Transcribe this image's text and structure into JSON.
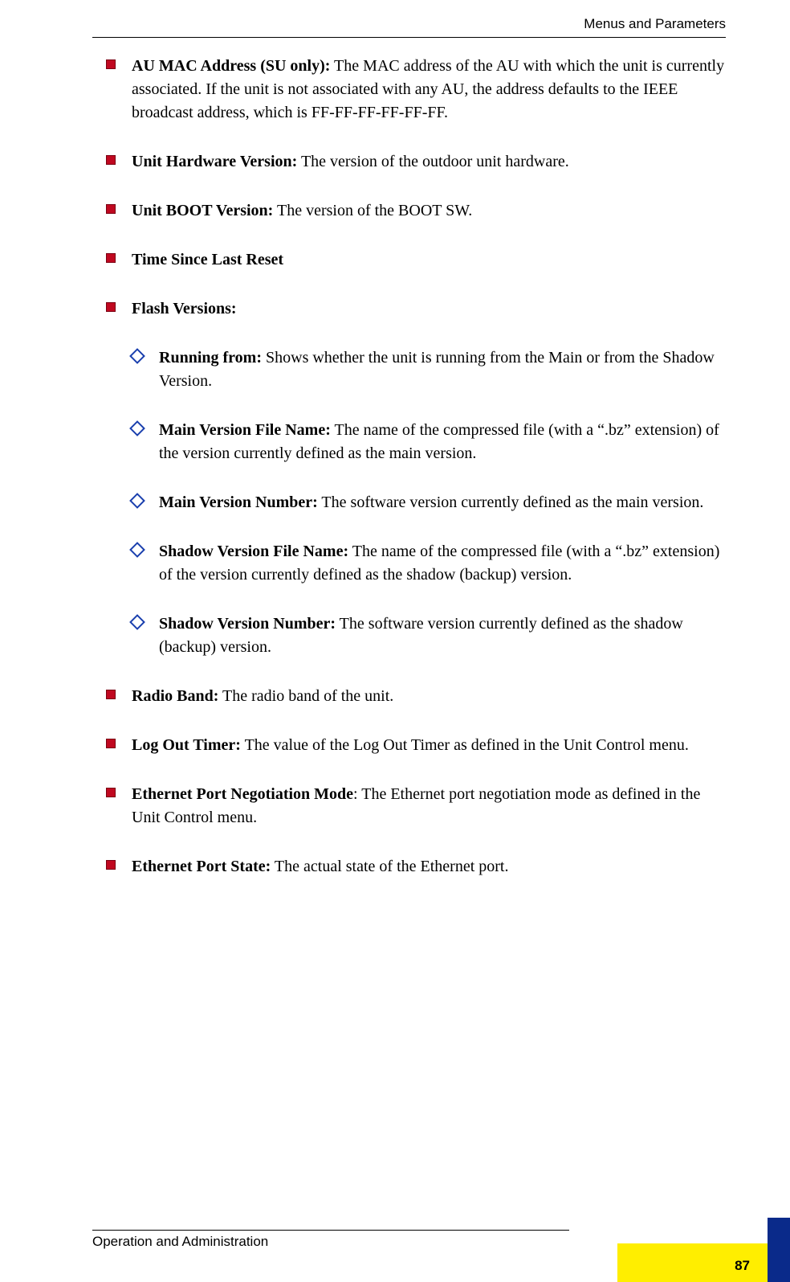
{
  "header": {
    "title": "Menus and Parameters"
  },
  "items": [
    {
      "label": "AU MAC Address (SU only):",
      "text": " The MAC address of the AU with which the unit is currently associated. If the unit is not associated with any AU, the address defaults to the IEEE broadcast address, which is FF-FF-FF-FF-FF-FF."
    },
    {
      "label": "Unit Hardware Version:",
      "text": " The version of the outdoor unit hardware."
    },
    {
      "label": "Unit BOOT Version:",
      "text": " The version of the BOOT SW."
    },
    {
      "label": "Time Since Last Reset",
      "text": ""
    },
    {
      "label": "Flash Versions:",
      "text": "",
      "sub": [
        {
          "label": "Running from:",
          "text": " Shows whether the unit is running from the Main or from the Shadow Version."
        },
        {
          "label": "Main Version File Name:",
          "text": " The name of the compressed file (with a “.bz” extension) of the version currently defined as the main version."
        },
        {
          "label": "Main Version Number:",
          "text": " The software version currently defined as the main version."
        },
        {
          "label": "Shadow Version File Name:",
          "text": " The name of the compressed file (with a “.bz” extension) of the version currently defined as the shadow (backup) version."
        },
        {
          "label": "Shadow Version Number:",
          "text": " The software version currently defined as the shadow (backup) version."
        }
      ]
    },
    {
      "label": "Radio Band:",
      "text": " The radio band of the unit."
    },
    {
      "label": "Log Out Timer:",
      "text": " The value of the Log Out Timer as defined in the Unit Control menu."
    },
    {
      "label": "Ethernet Port Negotiation Mode",
      "text": ": The Ethernet port negotiation mode as defined in the Unit Control menu."
    },
    {
      "label": "Ethernet Port State:",
      "text": " The actual state of the Ethernet port."
    }
  ],
  "footer": {
    "text": "Operation and Administration",
    "page": "87"
  }
}
